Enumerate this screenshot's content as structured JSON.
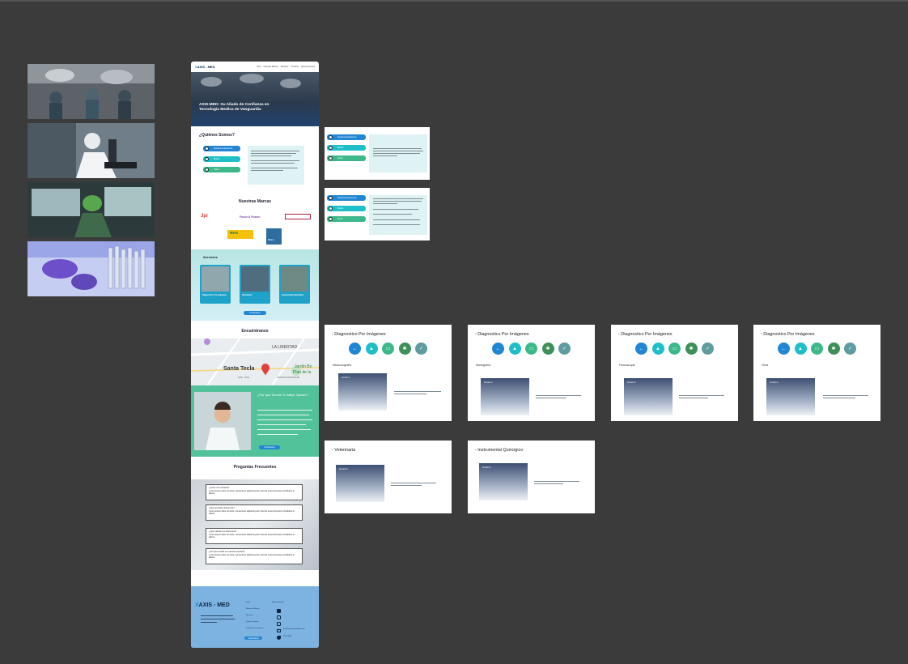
{
  "site": {
    "logo_x": "X",
    "logo_text": "AXIS - MED",
    "nav": [
      "Inicio",
      "Nuestras Marcas",
      "Servicios",
      "Contacto",
      "Quienes Somos"
    ],
    "hero_title": "AXIS-MED: Su Aliado de Confianza en Tecnología Medica de Vanguardia",
    "quienes_title": "¿Quiénes Somos?",
    "quienes_pills": [
      "Nuestra Experiencia",
      "Misión",
      "Visión"
    ],
    "marcas_title": "Nuestras Marcas",
    "brands": [
      "Jpi",
      "Focus & Fusion",
      "MAG",
      "VILLA"
    ],
    "servicios_title": "Servicios",
    "services": [
      "Diagnostico Por Imágenes",
      "Veterinaria",
      "Instrumental Quirúrgico"
    ],
    "servicios_button": "Contactanos",
    "encuentranos_title": "Encuéntranos",
    "map_labels": [
      "LA LIBERTAD",
      "Santa Tecla",
      "Jardín Bo",
      "Plan de la",
      "ANTIGUO CUSCATLÁN",
      "COL. UTIL"
    ],
    "porque_title": "¿Por qué Somos Tu Mejor Opción?",
    "porque_button": "Contactanos",
    "faq_title": "Preguntas Frecuentes",
    "faq": [
      {
        "q": "¿Como nos contacto?",
        "a": "Lorem ipsum dolor sit amet, consectetur adipiscing elit. Sed do eiusmod tempor incididunt ut labore"
      },
      {
        "q": "¿Qué servicios ofrecemos?",
        "a": "Lorem ipsum dolor sit amet, consectetur adipiscing elit. Sed do eiusmod tempor incididunt ut labore"
      },
      {
        "q": "¿Qué marcas me ofrecemos?",
        "a": "Lorem ipsum dolor sit amet, consectetur adipiscing elit. Sed do eiusmod tempor incididunt ut labore"
      },
      {
        "q": "¿Por qué confiar en nuestra empresa?",
        "a": "Lorem ipsum dolor sit amet, consectetur adipiscing elit. Sed do eiusmod tempor incididunt ut labore"
      }
    ],
    "footer_links": [
      "Inicio",
      "Nuestras Marcas",
      "Servicios",
      "Quienes Somos",
      "Preguntas Frecuentes"
    ],
    "footer_social_title": "Redes Sociales",
    "footer_email": "info@axismedsalvador.com",
    "footer_phone": "2523-2800",
    "footer_button": "Contactanos"
  },
  "panels": {
    "panel1_pills": [
      "Nuestra Experiencia",
      "Misión",
      "Visión"
    ],
    "panel2_pills": [
      "Nuestra Experiencia",
      "Misión",
      "Visión"
    ]
  },
  "frames": [
    {
      "title": "Diagnostico Por Imágenes",
      "sub": "Ultrasonografía",
      "card": "Servicio 1"
    },
    {
      "title": "Diagnostico Por Imágenes",
      "sub": "Mamografía",
      "card": "Servicio 2"
    },
    {
      "title": "Diagnostico Por Imágenes",
      "sub": "Fluoroscopia",
      "card": "Servicio 3"
    },
    {
      "title": "Diagnostico Por Imágenes",
      "sub": "Otros",
      "card": "Servicio 4"
    },
    {
      "title": "Veterinaria",
      "sub": "",
      "card": "Servicio 5"
    },
    {
      "title": "Instrumental Quirúrgico",
      "sub": "",
      "card": "Servicio 6"
    }
  ],
  "colors": {
    "canvas": "#3b3b3b",
    "blue": "#2186d4",
    "teal": "#1ebfc9",
    "green": "#3cb88a",
    "darkgreen": "#3e8f5a",
    "grayteal": "#5e9c9f"
  },
  "icons": [
    "arrow-left-icon",
    "warning-triangle-icon",
    "monitor-icon",
    "bug-icon",
    "check-icon"
  ]
}
